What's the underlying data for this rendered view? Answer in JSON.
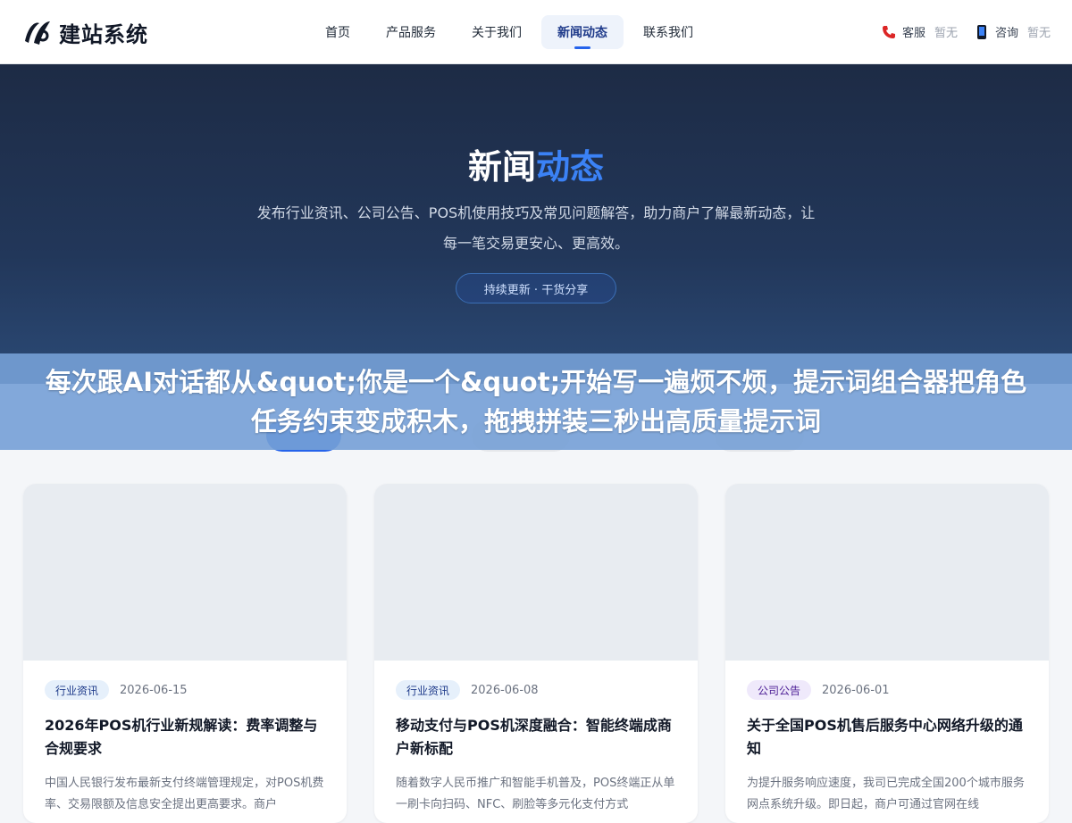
{
  "header": {
    "logo_text": "建站系统",
    "nav": [
      {
        "label": "首页",
        "active": false
      },
      {
        "label": "产品服务",
        "active": false
      },
      {
        "label": "关于我们",
        "active": false
      },
      {
        "label": "新闻动态",
        "active": true
      },
      {
        "label": "联系我们",
        "active": false
      }
    ],
    "contacts": [
      {
        "icon": "phone-icon",
        "label": "客服",
        "value": "暂无"
      },
      {
        "icon": "mobile-icon",
        "label": "咨询",
        "value": "暂无"
      }
    ]
  },
  "hero": {
    "title_main": "新闻",
    "title_accent": "动态",
    "subtitle": "发布行业资讯、公司公告、POS机使用技巧及常见问题解答，助力商户了解最新动态，让每一笔交易更安心、更高效。",
    "badge": "持续更新 · 干货分享"
  },
  "overlay": {
    "text": "每次跟AI对话都从&quot;你是一个&quot;开始写一遍烦不烦，提示词组合器把角色任务约束变成积木，拖拽拼装三秒出高质量提示词"
  },
  "cards": [
    {
      "tag": "行业资讯",
      "date": "2026-06-15",
      "title": "2026年POS机行业新规解读：费率调整与合规要求",
      "desc": "中国人民银行发布最新支付终端管理规定，对POS机费率、交易限额及信息安全提出更高要求。商户"
    },
    {
      "tag": "行业资讯",
      "date": "2026-06-08",
      "title": "移动支付与POS机深度融合：智能终端成商户新标配",
      "desc": "随着数字人民币推广和智能手机普及，POS终端正从单一刷卡向扫码、NFC、刷脸等多元化支付方式"
    },
    {
      "tag": "公司公告",
      "date": "2026-06-01",
      "title": "关于全国POS机售后服务中心网络升级的通知",
      "desc": "为提升服务响应速度，我司已完成全国200个城市服务网点系统升级。即日起，商户可通过官网在线"
    }
  ],
  "colors": {
    "accent": "#2563eb",
    "hero_bg": "#1d2b45",
    "overlay_bg": "#76a0d6"
  }
}
